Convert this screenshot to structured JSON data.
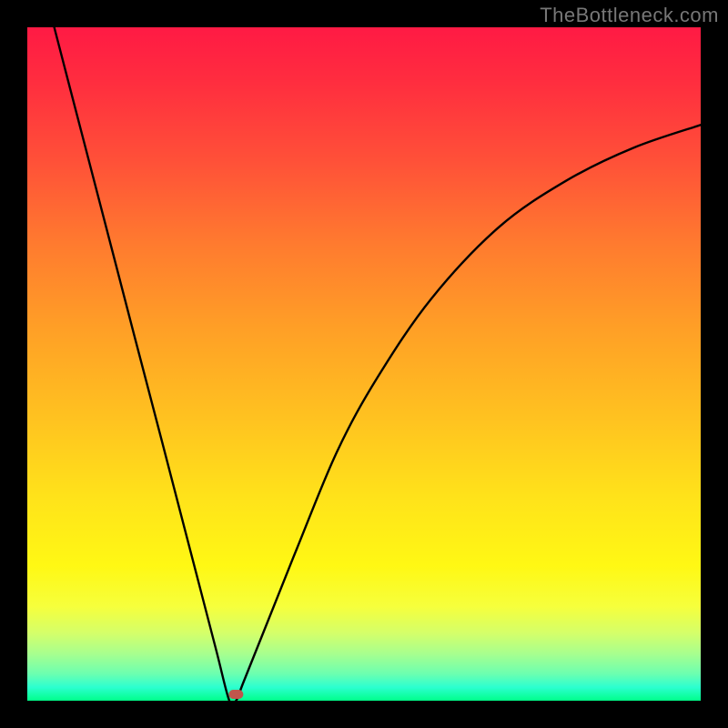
{
  "watermark": "TheBottleneck.com",
  "chart_data": {
    "type": "line",
    "title": "",
    "xlabel": "",
    "ylabel": "",
    "xlim": [
      0,
      100
    ],
    "ylim": [
      0,
      100
    ],
    "grid": false,
    "legend": false,
    "background_gradient": {
      "direction": "top-to-bottom",
      "stops": [
        {
          "pos": 0,
          "color": "#ff1a44"
        },
        {
          "pos": 20,
          "color": "#ff5138"
        },
        {
          "pos": 45,
          "color": "#ffa026"
        },
        {
          "pos": 70,
          "color": "#ffe31a"
        },
        {
          "pos": 90,
          "color": "#d4ff6a"
        },
        {
          "pos": 100,
          "color": "#00ff8a"
        }
      ]
    },
    "series": [
      {
        "name": "curve",
        "x": [
          4,
          8,
          12,
          16,
          20,
          24,
          28,
          30,
          31,
          32,
          35,
          40,
          46,
          52,
          60,
          70,
          80,
          90,
          100
        ],
        "y": [
          100,
          84.6,
          69.2,
          53.8,
          38.5,
          23.1,
          7.7,
          0,
          0,
          2.5,
          10.0,
          22.5,
          37.0,
          48.0,
          59.7,
          70.3,
          77.2,
          82.1,
          85.5
        ]
      }
    ],
    "marker": {
      "x": 31,
      "y": 0,
      "color": "#c0564c",
      "shape": "rounded-rect"
    }
  }
}
